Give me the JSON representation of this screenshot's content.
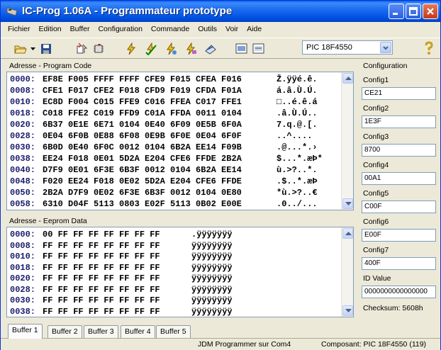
{
  "window": {
    "title": "IC-Prog 1.06A - Programmateur prototype"
  },
  "menu": [
    "Fichier",
    "Edition",
    "Buffer",
    "Configuration",
    "Commande",
    "Outils",
    "Voir",
    "Aide"
  ],
  "toolbar": {
    "device": "PIC 18F4550",
    "icons": [
      "open-icon",
      "save-icon",
      "read-icon",
      "chip-icon",
      "program-icon",
      "verify-icon",
      "erase-icon",
      "blank-check-icon",
      "stop-icon",
      "view-icon",
      "view-icon-2",
      "help-icon"
    ]
  },
  "program_code": {
    "title": "Adresse - Program Code",
    "rows": [
      [
        "0000:",
        "EF8E F005 FFFF FFFF CFE9 F015 CFEA F016",
        "Ž.ÿÿé.ê."
      ],
      [
        "0008:",
        "CFE1 F017 CFE2 F018 CFD9 F019 CFDA F01A",
        "á.â.Ù.Ú."
      ],
      [
        "0010:",
        "EC8D F004 C015 FFE9 C016 FFEA C017 FFE1",
        "□..é.ê.á"
      ],
      [
        "0018:",
        "C018 FFE2 C019 FFD9 C01A FFDA 0011 0104",
        ".â.Ù.Ú.."
      ],
      [
        "0020:",
        "6B37 0E1E 6E71 0104 0E40 6F09 0E5B 6F0A",
        "7.q.@.[."
      ],
      [
        "0028:",
        "0E04 6F0B 0E88 6F08 0E9B 6F0E 0E04 6F0F",
        "..^...."
      ],
      [
        "0030:",
        "6B0D 0E40 6F0C 0012 0104 6B2A EE14 F09B",
        ".@...*.›"
      ],
      [
        "0038:",
        "EE24 F018 0E01 5D2A E204 CFE6 FFDE 2B2A",
        "$...*.æÞ*"
      ],
      [
        "0040:",
        "D7F9 0E01 6F3E 6B3F 0012 0104 6B2A EE14",
        "ù.>?..*."
      ],
      [
        "0048:",
        "F020 EE24 F018 0E02 5D2A E204 CFE6 FFDE",
        ".$..*.æÞ"
      ],
      [
        "0050:",
        "2B2A D7F9 0E02 6F3E 6B3F 0012 0104 0E80",
        "*ù.>?..€"
      ],
      [
        "0058:",
        "6310 D04F 5113 0803 E02F 5113 0B02 E00E",
        ".0../..."
      ]
    ]
  },
  "eeprom": {
    "title": "Adresse - Eeprom Data",
    "rows": [
      [
        "0000:",
        "00 FF FF FF FF FF FF FF",
        ".ÿÿÿÿÿÿÿ"
      ],
      [
        "0008:",
        "FF FF FF FF FF FF FF FF",
        "ÿÿÿÿÿÿÿÿ"
      ],
      [
        "0010:",
        "FF FF FF FF FF FF FF FF",
        "ÿÿÿÿÿÿÿÿ"
      ],
      [
        "0018:",
        "FF FF FF FF FF FF FF FF",
        "ÿÿÿÿÿÿÿÿ"
      ],
      [
        "0020:",
        "FF FF FF FF FF FF FF FF",
        "ÿÿÿÿÿÿÿÿ"
      ],
      [
        "0028:",
        "FF FF FF FF FF FF FF FF",
        "ÿÿÿÿÿÿÿÿ"
      ],
      [
        "0030:",
        "FF FF FF FF FF FF FF FF",
        "ÿÿÿÿÿÿÿÿ"
      ],
      [
        "0038:",
        "FF FF FF FF FF FF FF FF",
        "ÿÿÿÿÿÿÿÿ"
      ]
    ]
  },
  "configuration": {
    "title": "Configuration",
    "fields": [
      {
        "label": "Config1",
        "value": "CE21"
      },
      {
        "label": "Config2",
        "value": "1E3F"
      },
      {
        "label": "Config3",
        "value": "8700"
      },
      {
        "label": "Config4",
        "value": "00A1"
      },
      {
        "label": "Config5",
        "value": "C00F"
      },
      {
        "label": "Config6",
        "value": "E00F"
      },
      {
        "label": "Config7",
        "value": "400F"
      },
      {
        "label": "ID Value",
        "value": "0000000000000000"
      }
    ],
    "checksum": "Checksum: 5608h"
  },
  "tabs": [
    "Buffer 1",
    "Buffer 2",
    "Buffer 3",
    "Buffer 4",
    "Buffer 5"
  ],
  "active_tab": "Buffer 1",
  "status": {
    "programmer": "JDM Programmer sur Com4",
    "component": "Composant: PIC 18F4550  (119)"
  }
}
